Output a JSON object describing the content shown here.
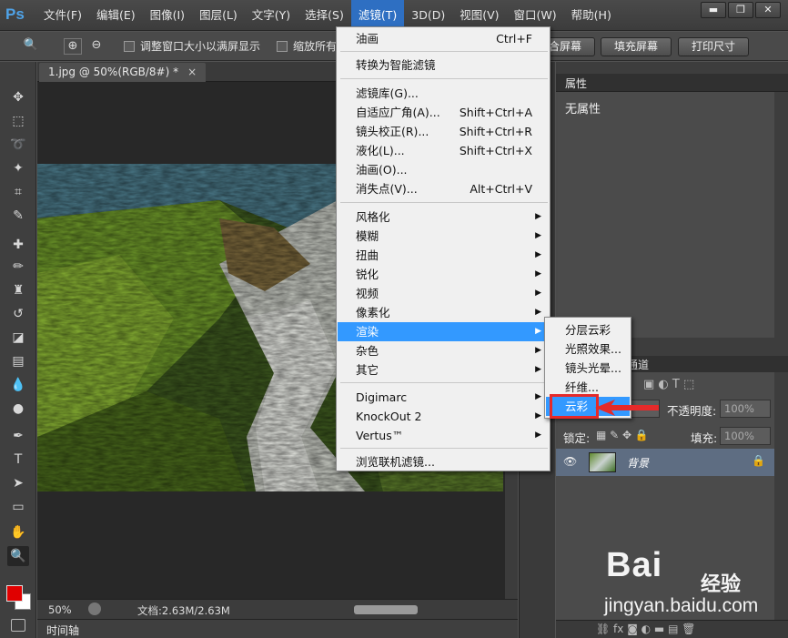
{
  "app": {
    "logo": "Ps"
  },
  "menubar": {
    "items": [
      "文件(F)",
      "编辑(E)",
      "图像(I)",
      "图层(L)",
      "文字(Y)",
      "选择(S)",
      "滤镜(T)",
      "3D(D)",
      "视图(V)",
      "窗口(W)",
      "帮助(H)"
    ],
    "active_index": 6
  },
  "window_controls": {
    "minimize": "▬",
    "restore": "❐",
    "close": "✕"
  },
  "options_bar": {
    "resize_windows_label": "调整窗口大小以满屏显示",
    "zoom_all_label": "缩放所有",
    "fit_screen_button": "合屏幕",
    "fill_screen_button": "填充屏幕",
    "print_size_button": "打印尺寸"
  },
  "document": {
    "tab_title": "1.jpg @ 50%(RGB/8#) *",
    "tab_close": "×",
    "zoom": "50%",
    "doc_info": "文档:2.63M/2.63M"
  },
  "timeline": {
    "label": "时间轴"
  },
  "properties_panel": {
    "title": "属性",
    "empty_text": "无属性"
  },
  "layers_panel": {
    "tab_label": "通道",
    "opacity_label": "不透明度:",
    "opacity_value": "100%",
    "lock_label": "锁定:",
    "fill_label": "填充:",
    "fill_value": "100%",
    "layer_name": "背景"
  },
  "filter_menu": {
    "items": [
      {
        "label": "油画",
        "shortcut": "Ctrl+F"
      },
      {
        "label": "转换为智能滤镜"
      },
      {
        "label": "滤镜库(G)..."
      },
      {
        "label": "自适应广角(A)...",
        "shortcut": "Shift+Ctrl+A"
      },
      {
        "label": "镜头校正(R)...",
        "shortcut": "Shift+Ctrl+R"
      },
      {
        "label": "液化(L)...",
        "shortcut": "Shift+Ctrl+X"
      },
      {
        "label": "油画(O)..."
      },
      {
        "label": "消失点(V)...",
        "shortcut": "Alt+Ctrl+V"
      },
      {
        "label": "风格化"
      },
      {
        "label": "模糊"
      },
      {
        "label": "扭曲"
      },
      {
        "label": "锐化"
      },
      {
        "label": "视频"
      },
      {
        "label": "像素化"
      },
      {
        "label": "渲染"
      },
      {
        "label": "杂色"
      },
      {
        "label": "其它"
      },
      {
        "label": "Digimarc"
      },
      {
        "label": "KnockOut 2"
      },
      {
        "label": "Vertus™"
      },
      {
        "label": "浏览联机滤镜..."
      }
    ],
    "highlighted": "渲染"
  },
  "render_submenu": {
    "items": [
      "分层云彩",
      "光照效果...",
      "镜头光晕...",
      "纤维...",
      "云彩"
    ],
    "highlighted": "云彩"
  },
  "watermark": {
    "brand": "Bai",
    "brand_suffix": "经验",
    "url": "jingyan.baidu.com"
  },
  "colors": {
    "foreground": "#e00000",
    "background": "#ffffff",
    "menu_highlight": "#3399ff",
    "annotation_red": "#e52a2a"
  }
}
